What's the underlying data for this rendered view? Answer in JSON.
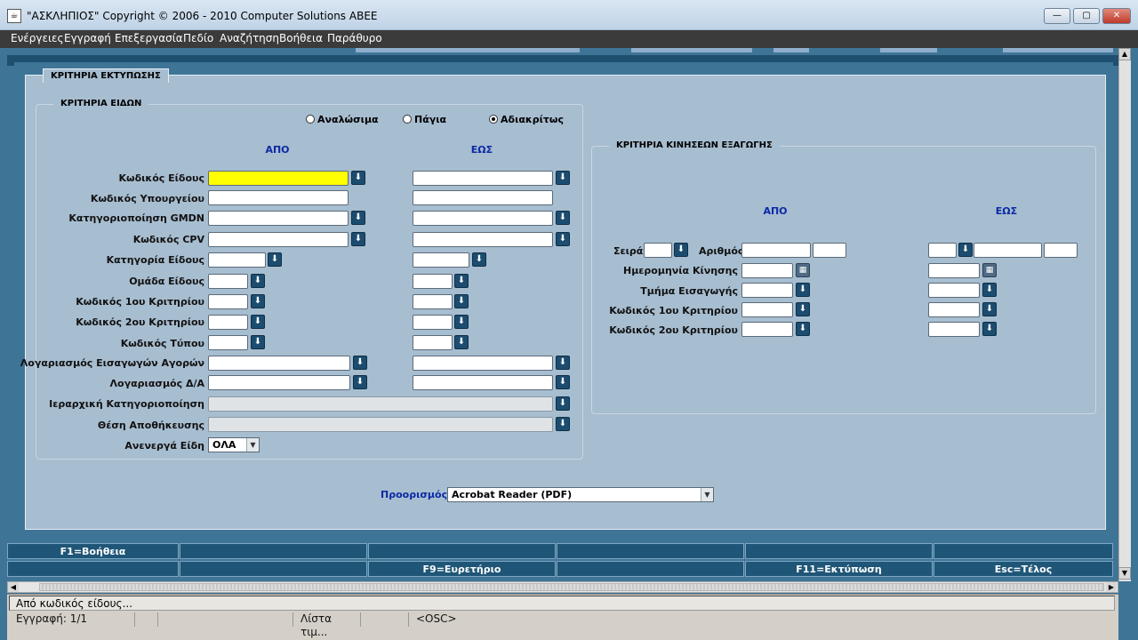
{
  "window": {
    "title": "\"ΑΣΚΛΗΠΙΟΣ\" Copyright © 2006 - 2010 Computer Solutions ΑΒΕΕ",
    "minimize_glyph": "—",
    "maximize_glyph": "▢",
    "close_glyph": "✕"
  },
  "menu": [
    "Ενέργειες",
    "Εγγραφή",
    "Επεξεργασία",
    "Πεδίο",
    "Αναζήτηση",
    "Βοήθεια",
    "Παράθυρο"
  ],
  "tab_label": "ΚΡΙΤΗΡΙΑ ΕΚΤΥΠΩΣΗΣ",
  "items_group": {
    "title": "ΚΡΙΤΗΡΙΑ ΕΙΔΩΝ",
    "radios": [
      {
        "label": "Αναλώσιμα",
        "selected": false
      },
      {
        "label": "Πάγια",
        "selected": false
      },
      {
        "label": "Αδιακρίτως",
        "selected": true
      }
    ],
    "from_header": "ΑΠΟ",
    "to_header": "ΕΩΣ",
    "rows": [
      "Κωδικός Είδους",
      "Κωδικός Υπουργείου",
      "Κατηγοριοποίηση GMDN",
      "Κωδικός CPV",
      "Κατηγορία Είδους",
      "Ομάδα Είδους",
      "Κωδικός 1ου Κριτηρίου",
      "Κωδικός 2ου Κριτηρίου",
      "Κωδικός Τύπου",
      "Λογαριασμός Εισαγωγών Αγορών",
      "Λογαριασμός Δ/Α",
      "Ιεραρχική Κατηγοριοποίηση",
      "Θέση Αποθήκευσης",
      "Ανενεργά Είδη"
    ],
    "inactive_value": "ΟΛΑ"
  },
  "movements_group": {
    "title": "ΚΡΙΤΗΡΙΑ ΚΙΝΗΣΕΩΝ ΕΞΑΓΩΓΗΣ",
    "from_header": "ΑΠΟ",
    "to_header": "ΕΩΣ",
    "series_label": "Σειρά",
    "number_label": "Αριθμός",
    "rows": [
      "Ημερομηνία Κίνησης",
      "Τμήμα Εισαγωγής",
      "Κωδικός 1ου Κριτηρίου",
      "Κωδικός 2ου Κριτηρίου"
    ]
  },
  "destination": {
    "label": "Προορισμός",
    "value": "Acrobat Reader (PDF)"
  },
  "fkeys": {
    "row1": [
      "F1=Βοήθεια",
      "",
      "",
      "",
      "",
      ""
    ],
    "row2": [
      "",
      "",
      "F9=Ευρετήριο",
      "",
      "F11=Εκτύπωση",
      "Esc=Τέλος"
    ]
  },
  "glyphs": {
    "lov": "⬇",
    "cal": "▦",
    "dropdown": "▼",
    "scroll_up": "▲",
    "scroll_down": "▼",
    "scroll_left": "◀",
    "scroll_right": "▶"
  },
  "status": {
    "message": "Από κωδικός είδους...",
    "record": "Εγγραφή: 1/1",
    "lov_hint": "Λίστα τιμ...",
    "mode": "<OSC>"
  }
}
